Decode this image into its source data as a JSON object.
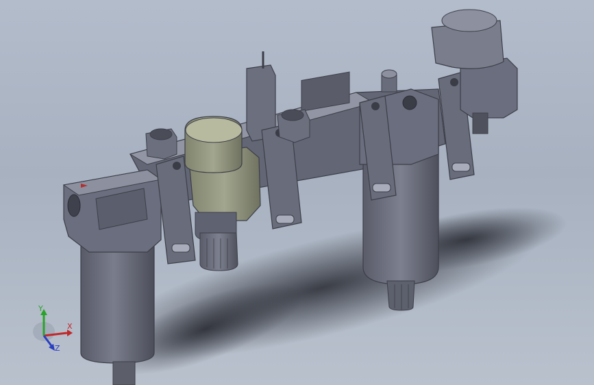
{
  "viewport": {
    "background_top": "#b3bccb",
    "background_bottom": "#b9c1cd",
    "model_name": "",
    "body_color": "#6b6e7e",
    "body_dark": "#4a4c58",
    "body_light": "#8a8d9c",
    "bracket_color": "#a8ab92",
    "head_color": "#8e9180"
  },
  "triad": {
    "x_label": "X",
    "y_label": "Y",
    "z_label": "Z",
    "x_color": "#c0282a",
    "y_color": "#2aa32a",
    "z_color": "#2a3ec0"
  }
}
